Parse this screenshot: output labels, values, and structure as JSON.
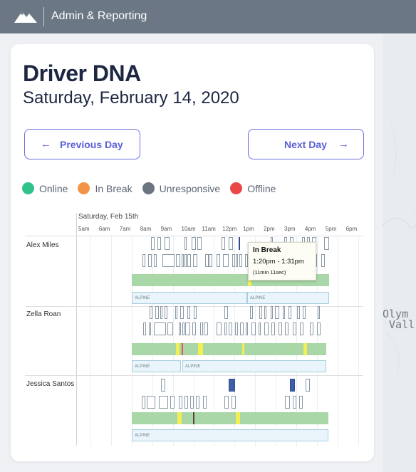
{
  "app": {
    "title": "Admin & Reporting",
    "logo_icon": "mountain-logo-icon"
  },
  "page": {
    "title": "Driver DNA",
    "date": "Saturday, February 14, 2020"
  },
  "nav": {
    "prev_label": "Previous Day",
    "prev_icon": "arrow-left-icon",
    "next_label": "Next Day",
    "next_icon": "arrow-right-icon"
  },
  "legend": [
    {
      "label": "Online",
      "color": "#2fc38a"
    },
    {
      "label": "In Break",
      "color": "#f29447"
    },
    {
      "label": "Unresponsive",
      "color": "#6c7480"
    },
    {
      "label": "Offline",
      "color": "#ea4747"
    }
  ],
  "timeline": {
    "date_label": "Saturday, Feb 15th",
    "hours": [
      "5am",
      "6am",
      "7am",
      "8am",
      "9am",
      "10am",
      "11am",
      "12pm",
      "1pm",
      "2pm",
      "3pm",
      "4pm",
      "5pm",
      "6pm"
    ],
    "drivers": [
      {
        "name": "Alex Miles",
        "vehicles": [
          "ALPINE",
          "ALPINE"
        ]
      },
      {
        "name": "Zella Roan",
        "vehicles": [
          "ALPINE",
          "ALPINE"
        ]
      },
      {
        "name": "Jessica Santos",
        "vehicles": [
          "ALPINE"
        ]
      }
    ]
  },
  "tooltip": {
    "title": "In Break",
    "range": "1:20pm - 1:31pm",
    "duration": "(11min 11sec)"
  },
  "map": {
    "labels": [
      "Olym",
      " Vall"
    ]
  },
  "colors": {
    "accent": "#5a5fd8",
    "online_bar": "#a9d7a8",
    "break_mark": "#f2ee55"
  }
}
